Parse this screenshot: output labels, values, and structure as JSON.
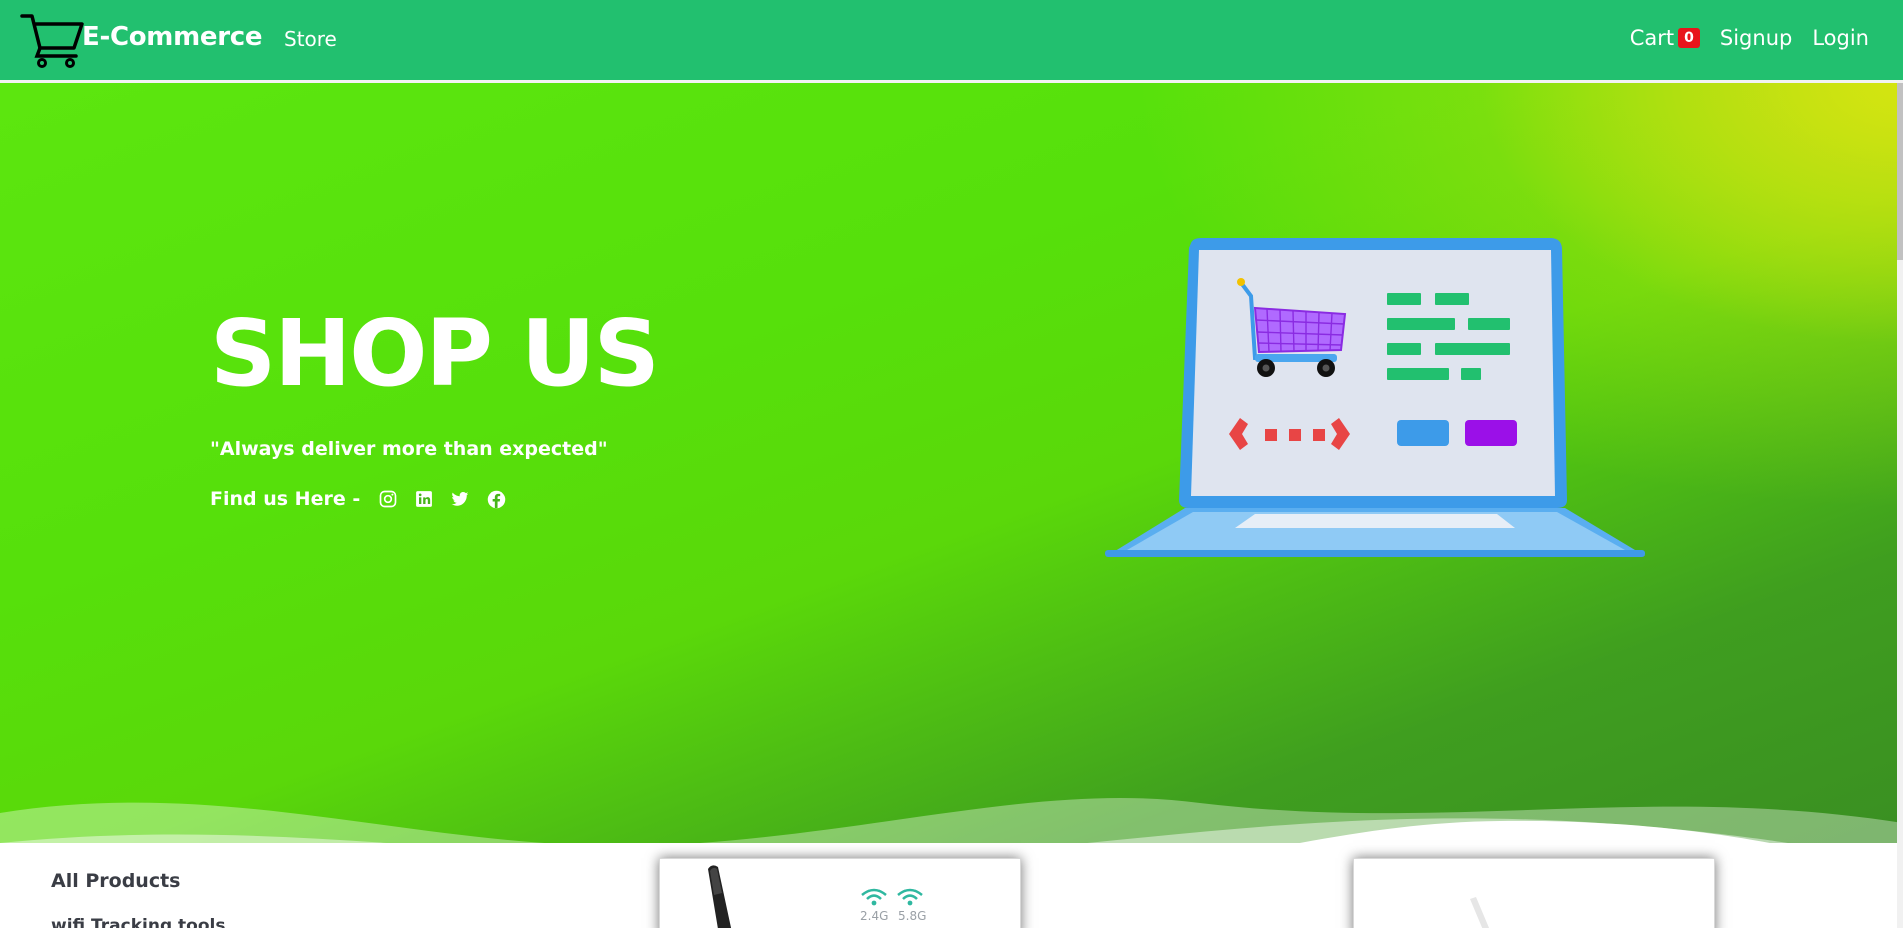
{
  "navbar": {
    "brand": "E-Commerce",
    "store_label": "Store",
    "cart_label": "Cart",
    "cart_count": "0",
    "signup_label": "Signup",
    "login_label": "Login"
  },
  "hero": {
    "title": "SHOP US",
    "quote": "\"Always deliver more than expected\"",
    "find_us_label": "Find us Here -",
    "social_icons": [
      "instagram-icon",
      "linkedin-icon",
      "twitter-icon",
      "facebook-icon"
    ]
  },
  "products": {
    "sidebar_title": "All Products",
    "sidebar_item_partial": "wifi Tracking tools",
    "wifi_labels": [
      "2.4G",
      "5.8G"
    ]
  },
  "colors": {
    "navbar_bg": "#22c06f",
    "hero_green": "#5ce60f",
    "hero_yellow": "#f0ec0a",
    "badge_red": "#e8141b"
  }
}
